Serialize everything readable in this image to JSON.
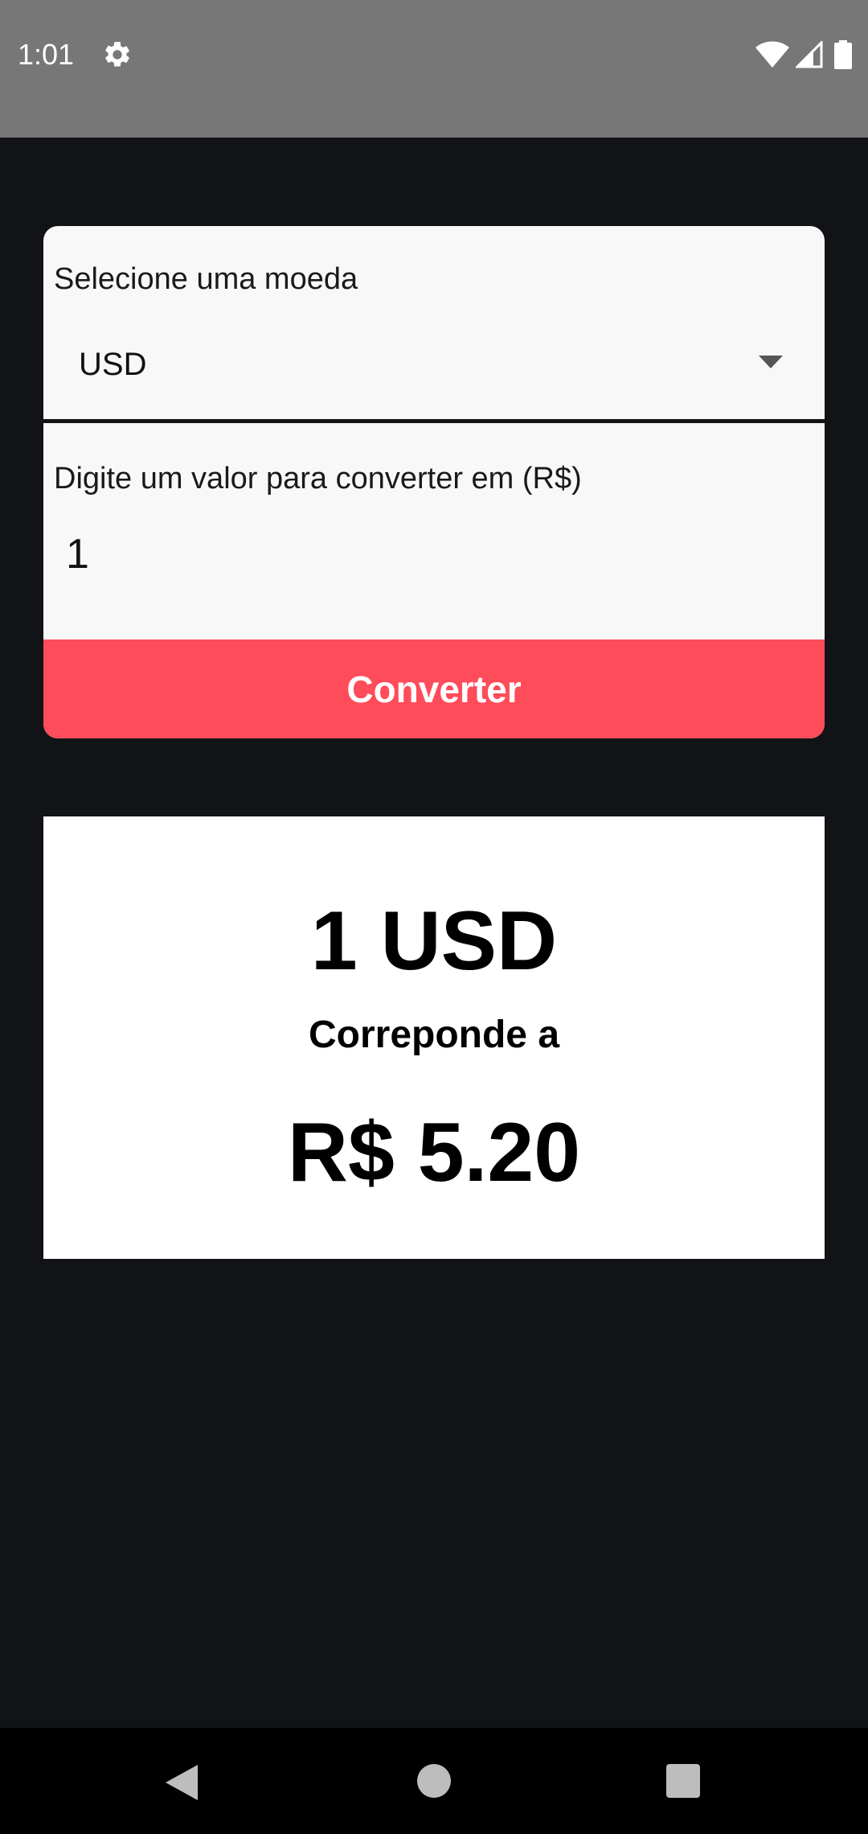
{
  "status_bar": {
    "time": "1:01",
    "icons": [
      "gear-icon",
      "wifi-icon",
      "signal-icon",
      "battery-icon"
    ]
  },
  "converter": {
    "select_label": "Selecione uma moeda",
    "selected_currency": "USD",
    "input_label": "Digite um valor para converter em (R$)",
    "input_value": "1",
    "button_label": "Converter"
  },
  "result": {
    "amount": "1 USD",
    "caption": "Correponde a",
    "value": "R$ 5.20"
  },
  "colors": {
    "background": "#121317",
    "accent": "#ff4c5b",
    "card": "#f8f8f8",
    "status_bar": "#777777"
  }
}
